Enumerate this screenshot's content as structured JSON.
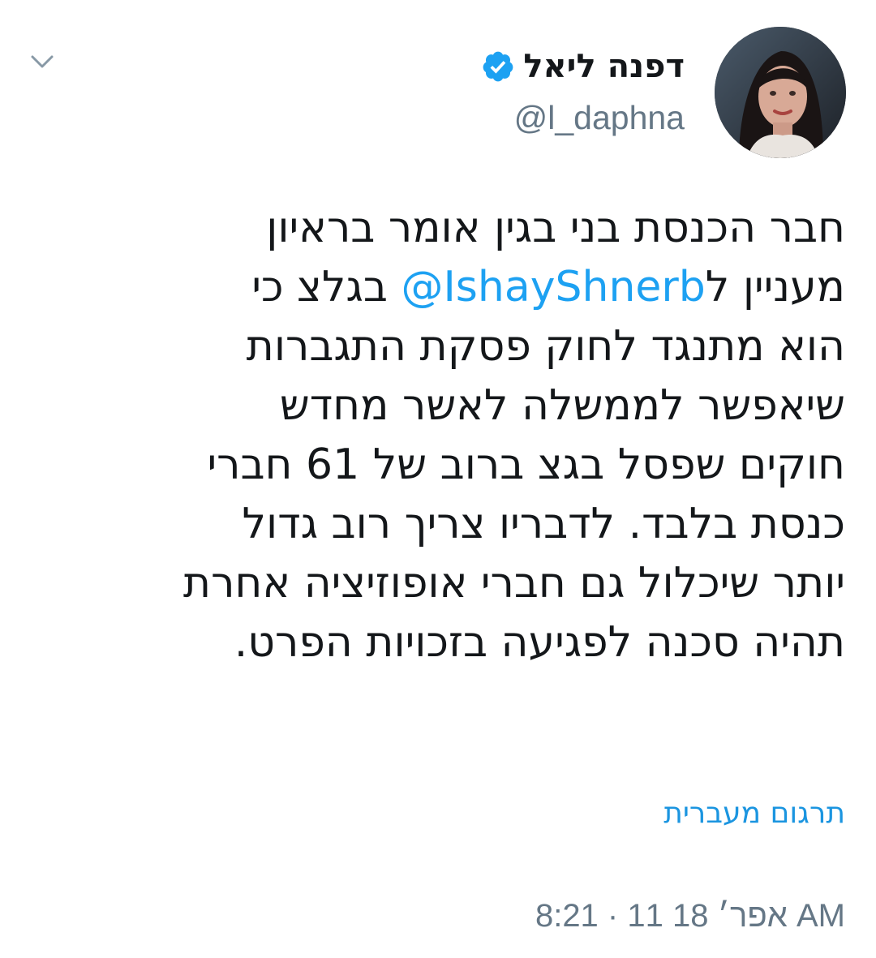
{
  "header": {
    "collapse_icon": "chevron-down-icon",
    "display_name": "דפנה ליאל",
    "verified_icon": "verified-badge-icon",
    "handle": "@l_daphna",
    "avatar_icon": "profile-photo"
  },
  "tweet": {
    "lines": {
      "l1": "חבר הכנסת בני בגין אומר בראיון",
      "l2_prefix": "מעניין ל",
      "l2_mention": "@IshayShnerb",
      "l2_suffix": " בגלצ כי",
      "l3": "הוא מתנגד לחוק פסקת התגברות",
      "l4": "שיאפשר לממשלה לאשר מחדש",
      "l5": "חוקים שפסל בגצ ברוב של 61 חברי",
      "l6": "כנסת בלבד. לדבריו צריך רוב גדול",
      "l7": "יותר שיכלול גם חברי אופוזיציה אחרת",
      "l8": "תהיה סכנה לפגיעה בזכויות הפרט."
    },
    "translate_label": "תרגום מעברית",
    "timestamp": "אפר׳ 18 11 · 8:21 AM"
  },
  "colors": {
    "text": "#14171a",
    "secondary": "#657786",
    "link": "#1da1f2",
    "verified": "#1da1f2"
  }
}
